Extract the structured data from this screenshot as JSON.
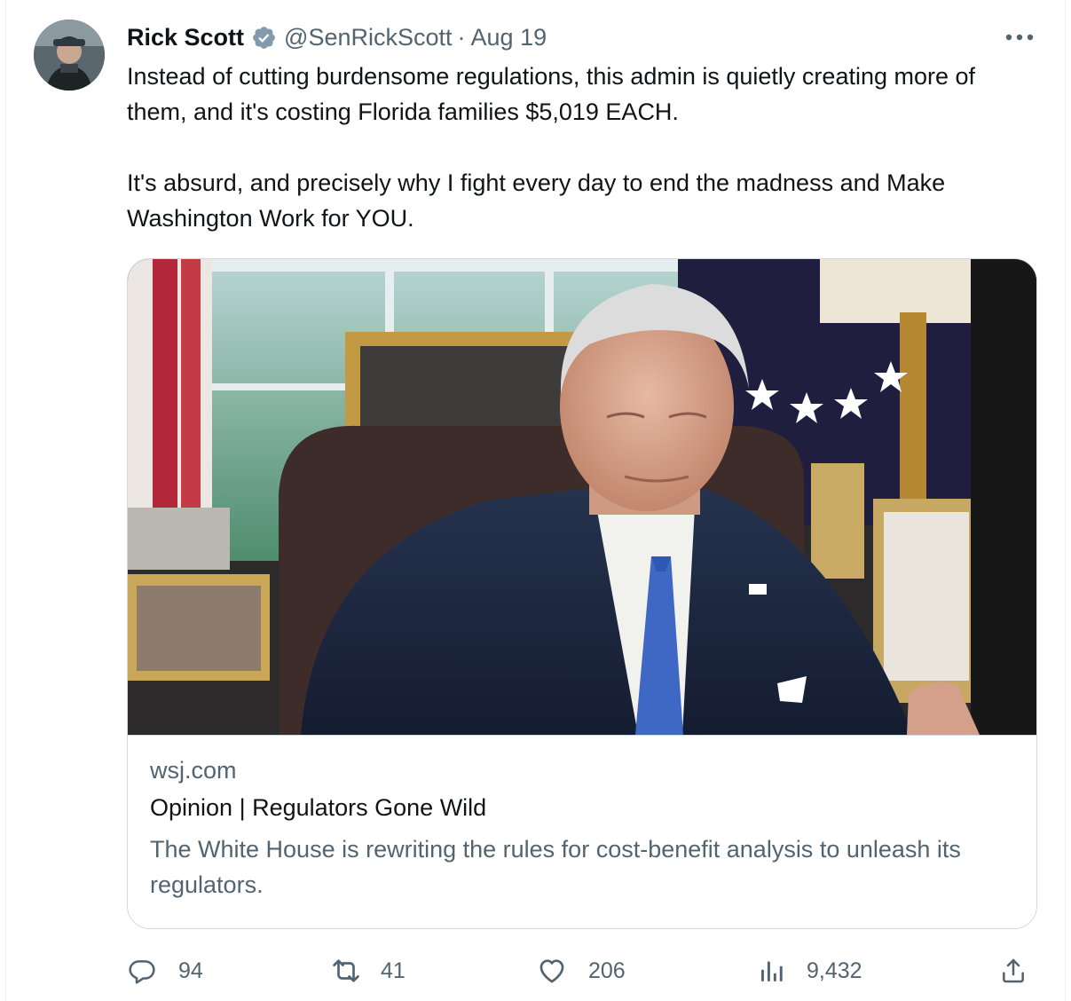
{
  "tweet": {
    "author": {
      "display_name": "Rick Scott",
      "handle": "@SenRickScott",
      "verified": true,
      "verified_badge_color": "#829aab"
    },
    "separator": "·",
    "timestamp": "Aug 19",
    "text": "Instead of cutting burdensome regulations, this admin is quietly creating more of them, and it's costing Florida families $5,019 EACH.\n\nIt's absurd, and precisely why I fight every day to end the madness and Make Washington Work for YOU.",
    "more_icon": "more-horizontal-icon"
  },
  "link_card": {
    "domain": "wsj.com",
    "title": "Opinion | Regulators Gone Wild",
    "description": "The White House is rewriting the rules for cost-benefit analysis to unleash its regulators."
  },
  "actions": {
    "reply": {
      "icon": "reply-icon",
      "count": "94"
    },
    "retweet": {
      "icon": "retweet-icon",
      "count": "41"
    },
    "like": {
      "icon": "heart-icon",
      "count": "206"
    },
    "views": {
      "icon": "views-icon",
      "count": "9,432"
    },
    "share": {
      "icon": "share-icon"
    }
  },
  "colors": {
    "text_primary": "#0f1419",
    "text_secondary": "#536471",
    "border": "#cfd9de",
    "icon": "#536471"
  }
}
